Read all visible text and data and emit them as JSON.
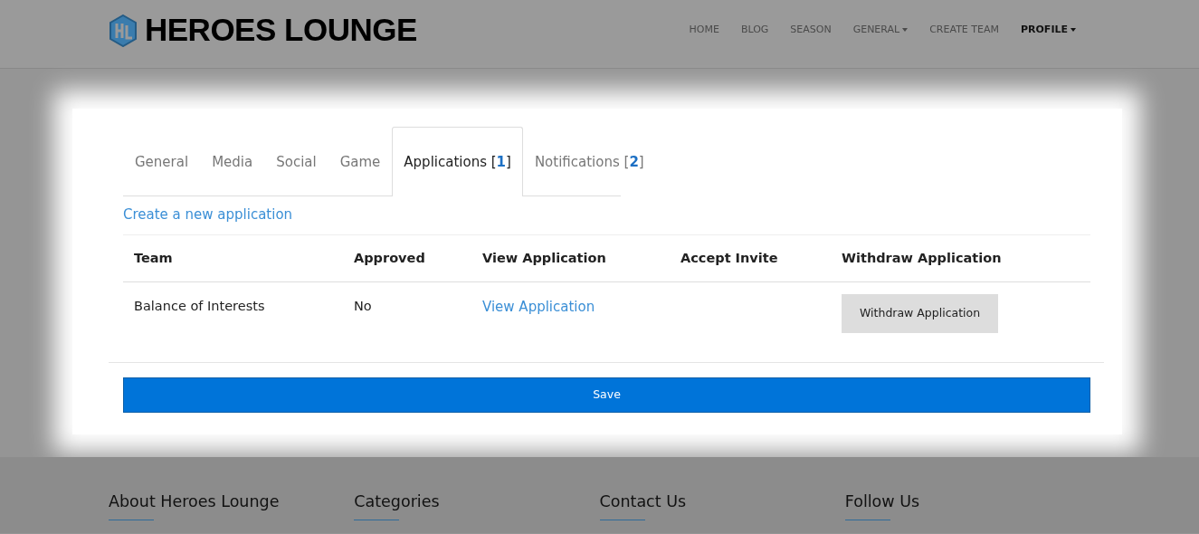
{
  "brand": {
    "title": "HEROES LOUNGE"
  },
  "nav": [
    {
      "label": "HOME",
      "dropdown": false,
      "selected": false
    },
    {
      "label": "BLOG",
      "dropdown": false,
      "selected": false
    },
    {
      "label": "SEASON",
      "dropdown": false,
      "selected": false
    },
    {
      "label": "GENERAL",
      "dropdown": true,
      "selected": false
    },
    {
      "label": "CREATE TEAM",
      "dropdown": false,
      "selected": false
    },
    {
      "label": "PROFILE",
      "dropdown": true,
      "selected": true
    }
  ],
  "tabs": [
    {
      "label": "General",
      "selected": false
    },
    {
      "label": "Media",
      "selected": false
    },
    {
      "label": "Social",
      "selected": false
    },
    {
      "label": "Game",
      "selected": false
    },
    {
      "label": "Applications [**1**]",
      "selected": true
    },
    {
      "label": "Notifications [**2**]",
      "selected": false
    }
  ],
  "create_link": "Create a new application",
  "table": {
    "columns": [
      "Team",
      "Approved",
      "View Application",
      "Accept Invite",
      "Withdraw Application"
    ],
    "rows": [
      {
        "team": "Balance of Interests",
        "approved": "No",
        "view_link": "View Application",
        "withdraw_button": "Withdraw Application"
      }
    ]
  },
  "save_button": "Save",
  "footer": [
    "About Heroes Lounge",
    "Categories",
    "Contact Us",
    "Follow Us"
  ]
}
